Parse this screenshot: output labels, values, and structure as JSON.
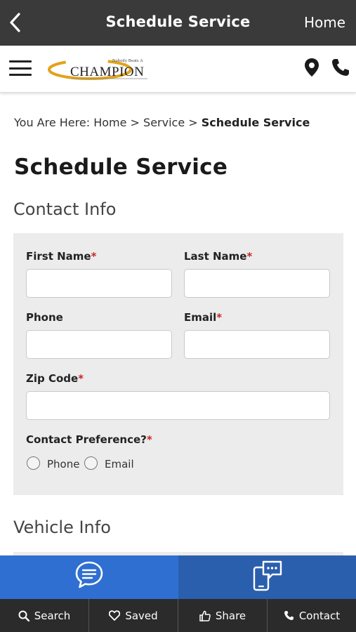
{
  "topbar": {
    "title": "Schedule Service",
    "home_label": "Home"
  },
  "header": {
    "logo_tagline": "Nobody Beats A",
    "logo_word": "CHAMPION"
  },
  "breadcrumb": {
    "prefix": "You Are Here:",
    "home": "Home",
    "sep1": ">",
    "service": "Service",
    "sep2": ">",
    "current": "Schedule Service"
  },
  "page_title": "Schedule Service",
  "contact_section": {
    "title": "Contact Info",
    "first_name_label": "First Name",
    "last_name_label": "Last Name",
    "phone_label": "Phone",
    "email_label": "Email",
    "zip_label": "Zip Code",
    "preference_label": "Contact Preference?",
    "required_mark": "*",
    "first_name_value": "",
    "last_name_value": "",
    "phone_value": "",
    "email_value": "",
    "zip_value": "",
    "options": [
      "Phone",
      "Email"
    ]
  },
  "vehicle_section": {
    "title": "Vehicle Info"
  },
  "bottom_nav": {
    "search": "Search",
    "saved": "Saved",
    "share": "Share",
    "contact": "Contact"
  },
  "colors": {
    "topbar": "#3a3a3a",
    "chat_left": "#2f6fd1",
    "chat_right": "#2a5fae",
    "nav": "#2b2b2b",
    "required": "#c62828",
    "form_bg": "#ececec",
    "logo_swoosh": "#e0a31a"
  }
}
